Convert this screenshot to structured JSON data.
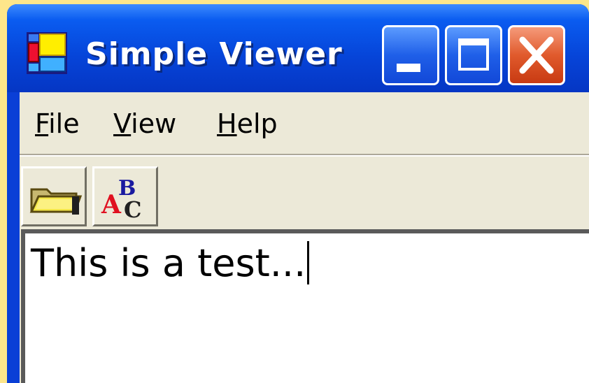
{
  "window": {
    "title": "Simple Viewer",
    "icons": {
      "app": "app-icon",
      "minimize": "minimize-icon",
      "maximize": "maximize-icon",
      "close": "close-icon"
    }
  },
  "menubar": {
    "items": [
      {
        "label": "File",
        "mnemonic": "F"
      },
      {
        "label": "View",
        "mnemonic": "V"
      },
      {
        "label": "Help",
        "mnemonic": "H"
      }
    ]
  },
  "toolbar": {
    "buttons": [
      {
        "icon": "open-folder-icon"
      },
      {
        "icon": "font-icon"
      }
    ]
  },
  "editor": {
    "text": "This is a test..."
  },
  "colors": {
    "titlebar": "#0644d8",
    "close_button": "#e05a2c",
    "client_background": "#ece9d8",
    "desktop": "#fde68a"
  }
}
